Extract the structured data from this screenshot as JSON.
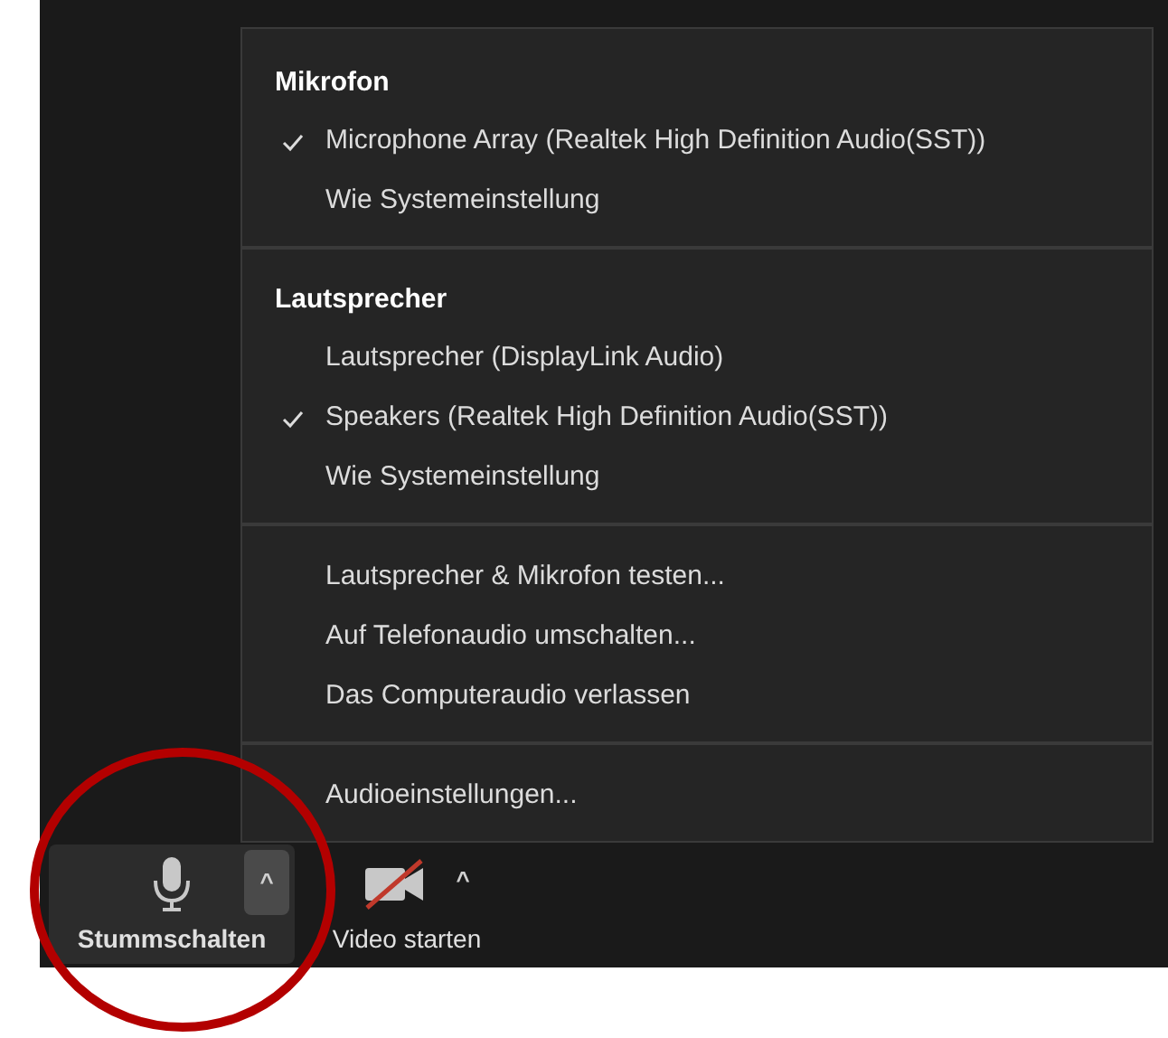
{
  "audio_menu": {
    "sections": [
      {
        "header": "Mikrofon",
        "items": [
          {
            "label": "Microphone Array (Realtek High Definition Audio(SST))",
            "checked": true
          },
          {
            "label": "Wie Systemeinstellung",
            "checked": false
          }
        ]
      },
      {
        "header": "Lautsprecher",
        "items": [
          {
            "label": "Lautsprecher (DisplayLink Audio)",
            "checked": false
          },
          {
            "label": "Speakers (Realtek High Definition Audio(SST))",
            "checked": true
          },
          {
            "label": "Wie Systemeinstellung",
            "checked": false
          }
        ]
      },
      {
        "items": [
          {
            "label": "Lautsprecher & Mikrofon testen...",
            "checked": false
          },
          {
            "label": "Auf Telefonaudio umschalten...",
            "checked": false
          },
          {
            "label": "Das Computeraudio verlassen",
            "checked": false
          }
        ]
      },
      {
        "items": [
          {
            "label": "Audioeinstellungen...",
            "checked": false
          }
        ]
      }
    ]
  },
  "toolbar": [
    {
      "kind": "mic",
      "label": "Stummschalten",
      "caret": "^",
      "hovered": true
    },
    {
      "kind": "video",
      "label": "Video starten",
      "caret": "^",
      "hovered": false
    }
  ]
}
